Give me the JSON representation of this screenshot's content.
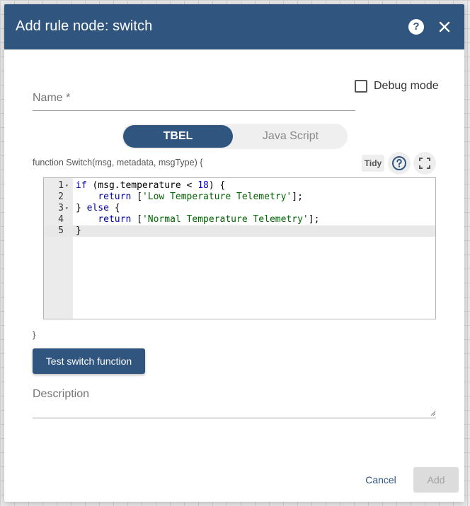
{
  "dialog": {
    "title": "Add rule node: switch",
    "help_icon_glyph": "?",
    "icons": {
      "help": "help-circle-icon",
      "close": "close-icon"
    }
  },
  "form": {
    "name_label": "Name *",
    "debug_label": "Debug mode",
    "debug_checked": false
  },
  "script_toggle": {
    "options": [
      "TBEL",
      "Java Script"
    ],
    "selected": "TBEL"
  },
  "editor": {
    "signature": "function Switch(msg, metadata, msgType) {",
    "tidy_label": "Tidy",
    "closing_brace": "}",
    "lines": [
      {
        "n": "1",
        "text": "if (msg.temperature < 18) {"
      },
      {
        "n": "2",
        "text": "    return ['Low Temperature Telemetry'];"
      },
      {
        "n": "3",
        "text": "} else {"
      },
      {
        "n": "4",
        "text": "    return ['Normal Temperature Telemetry'];"
      },
      {
        "n": "5",
        "text": "}"
      }
    ],
    "active_line": 5
  },
  "test_button_label": "Test switch function",
  "description_label": "Description",
  "footer": {
    "cancel_label": "Cancel",
    "add_label": "Add"
  },
  "colors": {
    "primary": "#305680",
    "disabled_bg": "#dcdcdc",
    "disabled_text": "#a0a0a0"
  }
}
